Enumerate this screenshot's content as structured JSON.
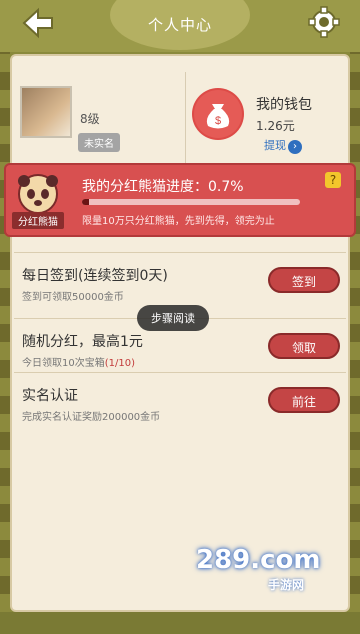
{
  "header": {
    "title": "个人中心",
    "back_icon": "back-arrow-icon",
    "settings_icon": "gear-icon"
  },
  "profile": {
    "level": "8级",
    "verify_badge": "未实名"
  },
  "wallet": {
    "title": "我的钱包",
    "amount": "1.26元",
    "withdraw": "提现",
    "withdraw_arrow": "›"
  },
  "banner": {
    "panda_label": "分红熊猫",
    "progress_title": "我的分红熊猫进度：0.7%",
    "progress_value": 0.007,
    "note": "限量10万只分红熊猫，先到先得，领完为止",
    "help": "?"
  },
  "tasks": [
    {
      "title": "每日签到(连续签到0天)",
      "desc": "签到可领取50000金币",
      "button": "签到"
    },
    {
      "title": "随机分红，最高1元",
      "desc_prefix": "今日领取10次宝箱",
      "desc_highlight": "(1/10)",
      "button": "领取"
    },
    {
      "title": "实名认证",
      "desc": "完成实名认证奖励200000金币",
      "button": "前往"
    }
  ],
  "tooltip": "步骤阅读",
  "watermark": {
    "main": "289.com",
    "sub": "手游网"
  },
  "colors": {
    "accent_red": "#c44545",
    "banner_red": "#d85050",
    "link_blue": "#2f6fbf",
    "panel_bg": "#f5eddc"
  }
}
